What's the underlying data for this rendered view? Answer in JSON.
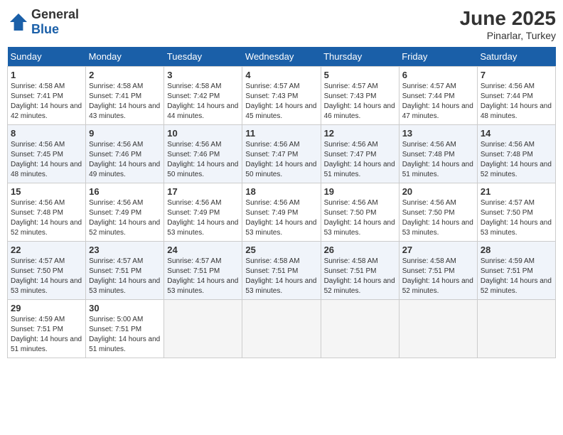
{
  "header": {
    "logo_general": "General",
    "logo_blue": "Blue",
    "month": "June 2025",
    "location": "Pinarlar, Turkey"
  },
  "weekdays": [
    "Sunday",
    "Monday",
    "Tuesday",
    "Wednesday",
    "Thursday",
    "Friday",
    "Saturday"
  ],
  "weeks": [
    [
      {
        "day": "1",
        "sunrise": "4:58 AM",
        "sunset": "7:41 PM",
        "daylight": "14 hours and 42 minutes."
      },
      {
        "day": "2",
        "sunrise": "4:58 AM",
        "sunset": "7:41 PM",
        "daylight": "14 hours and 43 minutes."
      },
      {
        "day": "3",
        "sunrise": "4:58 AM",
        "sunset": "7:42 PM",
        "daylight": "14 hours and 44 minutes."
      },
      {
        "day": "4",
        "sunrise": "4:57 AM",
        "sunset": "7:43 PM",
        "daylight": "14 hours and 45 minutes."
      },
      {
        "day": "5",
        "sunrise": "4:57 AM",
        "sunset": "7:43 PM",
        "daylight": "14 hours and 46 minutes."
      },
      {
        "day": "6",
        "sunrise": "4:57 AM",
        "sunset": "7:44 PM",
        "daylight": "14 hours and 47 minutes."
      },
      {
        "day": "7",
        "sunrise": "4:56 AM",
        "sunset": "7:44 PM",
        "daylight": "14 hours and 48 minutes."
      }
    ],
    [
      {
        "day": "8",
        "sunrise": "4:56 AM",
        "sunset": "7:45 PM",
        "daylight": "14 hours and 48 minutes."
      },
      {
        "day": "9",
        "sunrise": "4:56 AM",
        "sunset": "7:46 PM",
        "daylight": "14 hours and 49 minutes."
      },
      {
        "day": "10",
        "sunrise": "4:56 AM",
        "sunset": "7:46 PM",
        "daylight": "14 hours and 50 minutes."
      },
      {
        "day": "11",
        "sunrise": "4:56 AM",
        "sunset": "7:47 PM",
        "daylight": "14 hours and 50 minutes."
      },
      {
        "day": "12",
        "sunrise": "4:56 AM",
        "sunset": "7:47 PM",
        "daylight": "14 hours and 51 minutes."
      },
      {
        "day": "13",
        "sunrise": "4:56 AM",
        "sunset": "7:48 PM",
        "daylight": "14 hours and 51 minutes."
      },
      {
        "day": "14",
        "sunrise": "4:56 AM",
        "sunset": "7:48 PM",
        "daylight": "14 hours and 52 minutes."
      }
    ],
    [
      {
        "day": "15",
        "sunrise": "4:56 AM",
        "sunset": "7:48 PM",
        "daylight": "14 hours and 52 minutes."
      },
      {
        "day": "16",
        "sunrise": "4:56 AM",
        "sunset": "7:49 PM",
        "daylight": "14 hours and 52 minutes."
      },
      {
        "day": "17",
        "sunrise": "4:56 AM",
        "sunset": "7:49 PM",
        "daylight": "14 hours and 53 minutes."
      },
      {
        "day": "18",
        "sunrise": "4:56 AM",
        "sunset": "7:49 PM",
        "daylight": "14 hours and 53 minutes."
      },
      {
        "day": "19",
        "sunrise": "4:56 AM",
        "sunset": "7:50 PM",
        "daylight": "14 hours and 53 minutes."
      },
      {
        "day": "20",
        "sunrise": "4:56 AM",
        "sunset": "7:50 PM",
        "daylight": "14 hours and 53 minutes."
      },
      {
        "day": "21",
        "sunrise": "4:57 AM",
        "sunset": "7:50 PM",
        "daylight": "14 hours and 53 minutes."
      }
    ],
    [
      {
        "day": "22",
        "sunrise": "4:57 AM",
        "sunset": "7:50 PM",
        "daylight": "14 hours and 53 minutes."
      },
      {
        "day": "23",
        "sunrise": "4:57 AM",
        "sunset": "7:51 PM",
        "daylight": "14 hours and 53 minutes."
      },
      {
        "day": "24",
        "sunrise": "4:57 AM",
        "sunset": "7:51 PM",
        "daylight": "14 hours and 53 minutes."
      },
      {
        "day": "25",
        "sunrise": "4:58 AM",
        "sunset": "7:51 PM",
        "daylight": "14 hours and 53 minutes."
      },
      {
        "day": "26",
        "sunrise": "4:58 AM",
        "sunset": "7:51 PM",
        "daylight": "14 hours and 52 minutes."
      },
      {
        "day": "27",
        "sunrise": "4:58 AM",
        "sunset": "7:51 PM",
        "daylight": "14 hours and 52 minutes."
      },
      {
        "day": "28",
        "sunrise": "4:59 AM",
        "sunset": "7:51 PM",
        "daylight": "14 hours and 52 minutes."
      }
    ],
    [
      {
        "day": "29",
        "sunrise": "4:59 AM",
        "sunset": "7:51 PM",
        "daylight": "14 hours and 51 minutes."
      },
      {
        "day": "30",
        "sunrise": "5:00 AM",
        "sunset": "7:51 PM",
        "daylight": "14 hours and 51 minutes."
      },
      null,
      null,
      null,
      null,
      null
    ]
  ],
  "labels": {
    "sunrise": "Sunrise:",
    "sunset": "Sunset:",
    "daylight": "Daylight:"
  }
}
